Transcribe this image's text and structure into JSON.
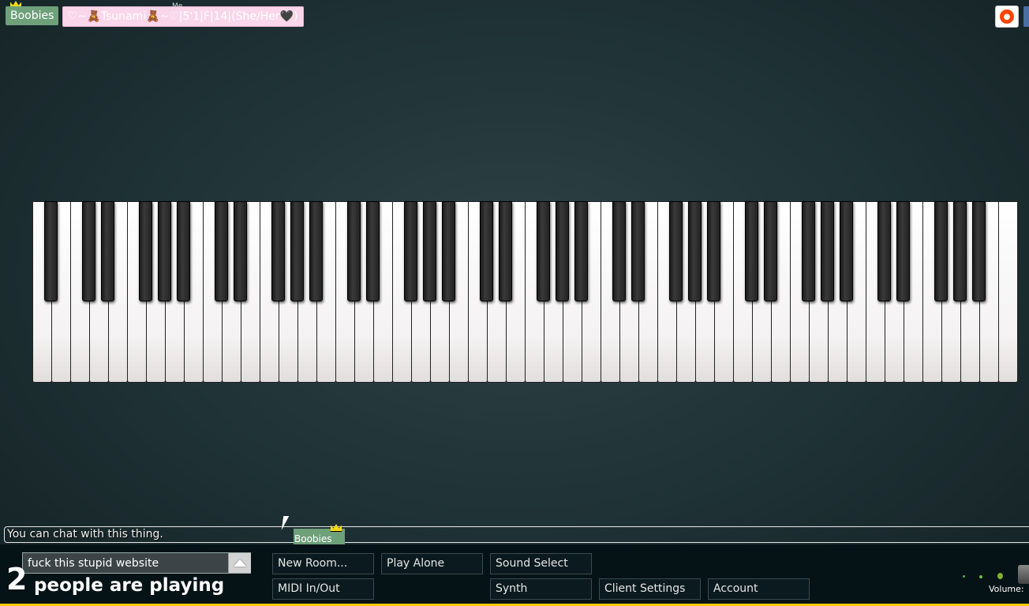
{
  "header": {
    "owner_tag": "Boobies",
    "me_label": "Me",
    "me_tag": "♡~🧸Tsunami🧸~♡|5'1|F|14|(She/Her🖤)",
    "icons": [
      "crown-icon",
      "reddit-icon"
    ]
  },
  "piano": {
    "white_keys": 52,
    "black_keys": 36
  },
  "chat": {
    "placeholder_message": "You can chat with this thing.",
    "input_value": "fuck this stupid website"
  },
  "cursor_tag": {
    "name": "Boobies"
  },
  "status": {
    "count": "2",
    "text": "people are playing"
  },
  "buttons": {
    "new_room": "New Room...",
    "play_alone": "Play Alone",
    "sound_select": "Sound Select",
    "midi": "MIDI In/Out",
    "synth": "Synth",
    "client_settings": "Client Settings",
    "account": "Account"
  },
  "volume": {
    "label": "Volume:"
  },
  "colors": {
    "owner_tag": "#6ea07a",
    "me_tag": "#f9d6ea",
    "bottom_accent": "#f2cd00"
  }
}
